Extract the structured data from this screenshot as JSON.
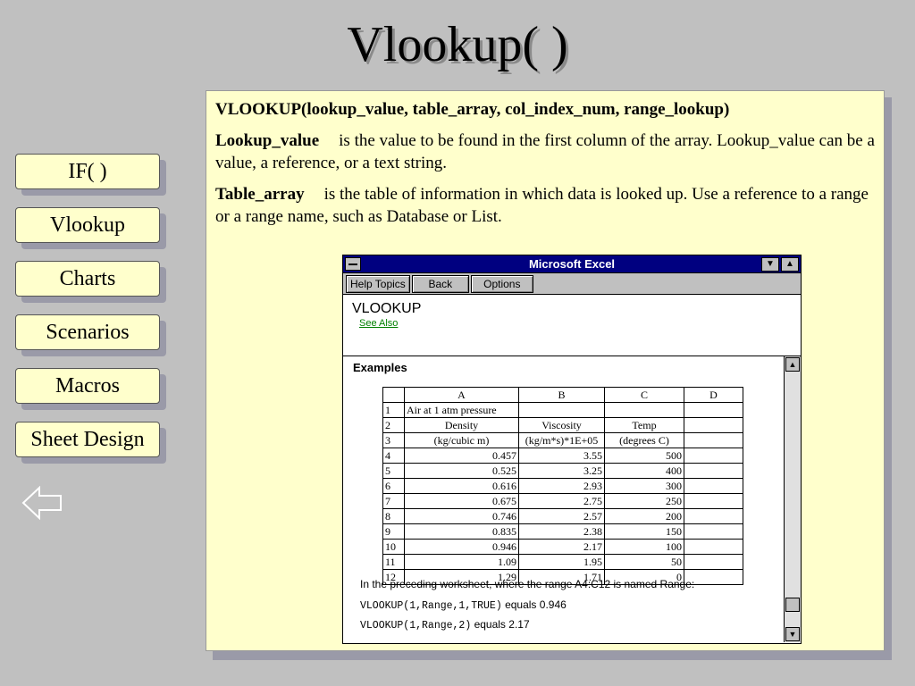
{
  "slide": {
    "title": "Vlookup( )"
  },
  "nav": [
    "IF( )",
    "Vlookup",
    "Charts",
    "Scenarios",
    "Macros",
    "Sheet Design"
  ],
  "content": {
    "syntax": "VLOOKUP(lookup_value, table_array, col_index_num, range_lookup)",
    "params": [
      {
        "term": "Lookup_value",
        "text": "is the value to be found in the first column of the array. Lookup_value can be a value, a reference, or a text string."
      },
      {
        "term": "Table_array",
        "text": "is the table of information in which data is looked up. Use a reference to a range or a range name, such as Database or List."
      }
    ]
  },
  "help": {
    "window_title": "Microsoft Excel",
    "buttons": [
      "Help Topics",
      "Back",
      "Options"
    ],
    "topic_title": "VLOOKUP",
    "see_also": "See Also",
    "examples_title": "Examples",
    "sheet": {
      "columns": [
        "A",
        "B",
        "C",
        "D"
      ],
      "rows": [
        [
          "1",
          "Air at 1 atm pressure",
          "",
          "",
          ""
        ],
        [
          "2",
          "Density",
          "Viscosity",
          "Temp",
          ""
        ],
        [
          "3",
          "(kg/cubic m)",
          "(kg/m*s)*1E+05",
          "(degrees C)",
          ""
        ],
        [
          "4",
          "0.457",
          "3.55",
          "500",
          ""
        ],
        [
          "5",
          "0.525",
          "3.25",
          "400",
          ""
        ],
        [
          "6",
          "0.616",
          "2.93",
          "300",
          ""
        ],
        [
          "7",
          "0.675",
          "2.75",
          "250",
          ""
        ],
        [
          "8",
          "0.746",
          "2.57",
          "200",
          ""
        ],
        [
          "9",
          "0.835",
          "2.38",
          "150",
          ""
        ],
        [
          "10",
          "0.946",
          "2.17",
          "100",
          ""
        ],
        [
          "11",
          "1.09",
          "1.95",
          "50",
          ""
        ],
        [
          "12",
          "1.29",
          "1.71",
          "0",
          ""
        ]
      ]
    },
    "note": "In the preceding worksheet, where the range A4:C12 is named Range:",
    "examples": [
      {
        "code": "VLOOKUP(1,Range,1,TRUE)",
        "text": " equals 0.946"
      },
      {
        "code": "VLOOKUP(1,Range,2)",
        "text": " equals 2.17"
      }
    ]
  },
  "icons": {
    "back": "back-arrow-icon",
    "system_menu": "system-menu-icon",
    "minimize": "minimize-icon",
    "maximize": "maximize-icon",
    "scroll_up": "scroll-up-icon",
    "scroll_down": "scroll-down-icon"
  }
}
